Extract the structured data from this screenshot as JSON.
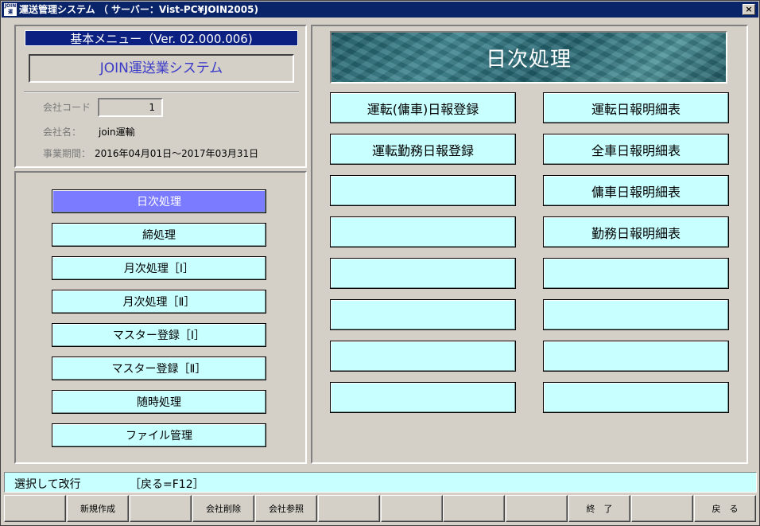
{
  "window": {
    "icon_text": "JOIN運",
    "title": "運送管理システム （ サーバー：Vist-PC¥JOIN2005)",
    "close_glyph": "×"
  },
  "info": {
    "menu_title": "基本メニュー（Ver. 02.000.006)",
    "system_name": "JOIN運送業システム",
    "company_code_label": "会社コード",
    "company_code_value": "1",
    "company_name_label": "会社名：",
    "company_name_value": "join運輸",
    "period_label": "事業期間：",
    "period_value": "2016年04月01日～2017年03月31日"
  },
  "left_menu": {
    "items": [
      "日次処理",
      "締処理",
      "月次処理［Ⅰ］",
      "月次処理［Ⅱ］",
      "マスター登録［Ⅰ］",
      "マスター登録［Ⅱ］",
      "随時処理",
      "ファイル管理"
    ],
    "selected_index": 0
  },
  "right_panel": {
    "header": "日次処理",
    "left_column": [
      "運転(傭車)日報登録",
      "運転勤務日報登録",
      "",
      "",
      "",
      "",
      "",
      ""
    ],
    "right_column": [
      "運転日報明細表",
      "全車日報明細表",
      "傭車日報明細表",
      "勤務日報明細表",
      "",
      "",
      "",
      ""
    ]
  },
  "status": {
    "hint": "選択して改行",
    "back_hint": "［戻る=F12］"
  },
  "function_keys": [
    "",
    "新規作成",
    "",
    "会社削除",
    "会社参照",
    "",
    "",
    "",
    "",
    "終　了",
    "",
    "戻　る"
  ],
  "colors": {
    "title_bar": "#0a246a",
    "button": "#c8ffff",
    "selected_button": "#7b7bff",
    "menu_title": "#0b2080",
    "system_name_text": "#3b3bc8"
  }
}
